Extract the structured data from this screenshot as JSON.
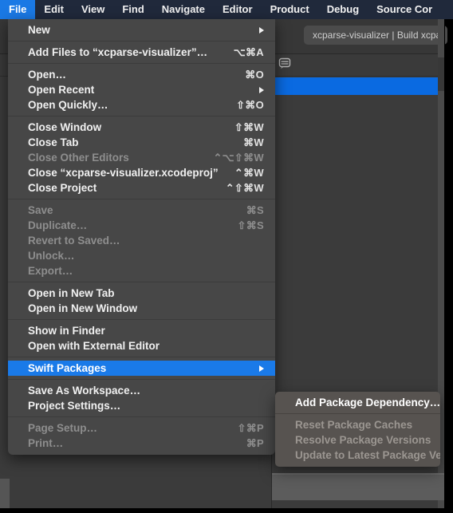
{
  "menubar": {
    "items": [
      {
        "label": "File",
        "active": true
      },
      {
        "label": "Edit",
        "active": false
      },
      {
        "label": "View",
        "active": false
      },
      {
        "label": "Find",
        "active": false
      },
      {
        "label": "Navigate",
        "active": false
      },
      {
        "label": "Editor",
        "active": false
      },
      {
        "label": "Product",
        "active": false
      },
      {
        "label": "Debug",
        "active": false
      },
      {
        "label": "Source Cor",
        "active": false
      }
    ]
  },
  "app": {
    "activity_status": "xcparse-visualizer | Build xcpa",
    "message_icon": "message-bubble-icon"
  },
  "file_menu": {
    "groups": [
      {
        "items": [
          {
            "label": "New",
            "key": "",
            "arrow": true,
            "disabled": false
          }
        ]
      },
      {
        "items": [
          {
            "label": "Add Files to “xcparse-visualizer”…",
            "key": "⌥⌘A",
            "arrow": false,
            "disabled": false
          }
        ]
      },
      {
        "items": [
          {
            "label": "Open…",
            "key": "⌘O",
            "arrow": false,
            "disabled": false
          },
          {
            "label": "Open Recent",
            "key": "",
            "arrow": true,
            "disabled": false
          },
          {
            "label": "Open Quickly…",
            "key": "⇧⌘O",
            "arrow": false,
            "disabled": false
          }
        ]
      },
      {
        "items": [
          {
            "label": "Close Window",
            "key": "⇧⌘W",
            "arrow": false,
            "disabled": false
          },
          {
            "label": "Close Tab",
            "key": "⌘W",
            "arrow": false,
            "disabled": false
          },
          {
            "label": "Close Other Editors",
            "key": "⌃⌥⇧⌘W",
            "arrow": false,
            "disabled": true
          },
          {
            "label": "Close “xcparse-visualizer.xcodeproj”",
            "key": "⌃⌘W",
            "arrow": false,
            "disabled": false
          },
          {
            "label": "Close Project",
            "key": "⌃⇧⌘W",
            "arrow": false,
            "disabled": false
          }
        ]
      },
      {
        "items": [
          {
            "label": "Save",
            "key": "⌘S",
            "arrow": false,
            "disabled": true
          },
          {
            "label": "Duplicate…",
            "key": "⇧⌘S",
            "arrow": false,
            "disabled": true
          },
          {
            "label": "Revert to Saved…",
            "key": "",
            "arrow": false,
            "disabled": true
          },
          {
            "label": "Unlock…",
            "key": "",
            "arrow": false,
            "disabled": true
          },
          {
            "label": "Export…",
            "key": "",
            "arrow": false,
            "disabled": true
          }
        ]
      },
      {
        "items": [
          {
            "label": "Open in New Tab",
            "key": "",
            "arrow": false,
            "disabled": false
          },
          {
            "label": "Open in New Window",
            "key": "",
            "arrow": false,
            "disabled": false
          }
        ]
      },
      {
        "items": [
          {
            "label": "Show in Finder",
            "key": "",
            "arrow": false,
            "disabled": false
          },
          {
            "label": "Open with External Editor",
            "key": "",
            "arrow": false,
            "disabled": false
          }
        ]
      },
      {
        "items": [
          {
            "label": "Swift Packages",
            "key": "",
            "arrow": true,
            "disabled": false,
            "highlight": true
          }
        ]
      },
      {
        "items": [
          {
            "label": "Save As Workspace…",
            "key": "",
            "arrow": false,
            "disabled": false
          },
          {
            "label": "Project Settings…",
            "key": "",
            "arrow": false,
            "disabled": false
          }
        ]
      },
      {
        "items": [
          {
            "label": "Page Setup…",
            "key": "⇧⌘P",
            "arrow": false,
            "disabled": true
          },
          {
            "label": "Print…",
            "key": "⌘P",
            "arrow": false,
            "disabled": true
          }
        ]
      }
    ]
  },
  "swift_packages_submenu": {
    "groups": [
      {
        "items": [
          {
            "label": "Add Package Dependency…",
            "key": "",
            "arrow": false,
            "disabled": false
          }
        ]
      },
      {
        "items": [
          {
            "label": "Reset Package Caches",
            "key": "",
            "arrow": false,
            "disabled": true
          },
          {
            "label": "Resolve Package Versions",
            "key": "",
            "arrow": false,
            "disabled": true
          },
          {
            "label": "Update to Latest Package Ve",
            "key": "",
            "arrow": false,
            "disabled": true
          }
        ]
      }
    ]
  },
  "colors": {
    "menubar_bg": "#20293b",
    "menubar_active": "#1a79e5",
    "menu_bg": "#474747",
    "submenu_bg": "#575350",
    "highlight": "#1a7ae8",
    "selection_row": "#0a6ae1",
    "disabled_text": "#8e8e8e"
  }
}
